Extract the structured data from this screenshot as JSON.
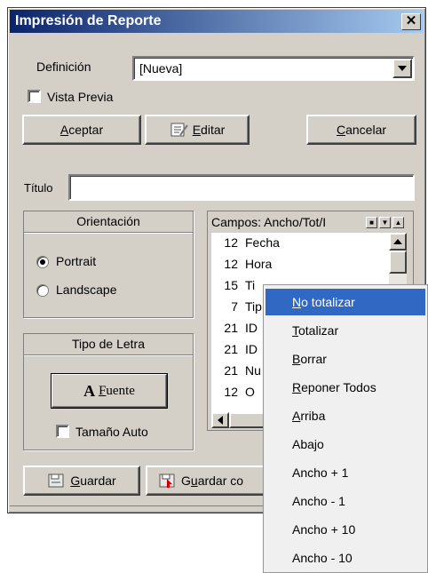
{
  "window": {
    "title": "Impresión de Reporte"
  },
  "definicion": {
    "label": "Definición",
    "value": "[Nueva]"
  },
  "vista_previa": {
    "label": "Vista Previa",
    "checked": false
  },
  "buttons": {
    "aceptar": {
      "u": "A",
      "rest": "ceptar"
    },
    "editar": {
      "u": "E",
      "rest": "ditar"
    },
    "cancelar": {
      "u": "C",
      "rest": "ancelar"
    },
    "fuente": {
      "icon": "A",
      "u": "F",
      "rest": "uente"
    },
    "guardar": {
      "u": "G",
      "rest": "uardar"
    },
    "guardar_como": {
      "pre": "G",
      "u": "u",
      "rest": "ardar co"
    }
  },
  "titulo": {
    "label": "Título",
    "value": ""
  },
  "orientacion": {
    "header": "Orientación",
    "options": [
      "Portrait",
      "Landscape"
    ],
    "selected": "Portrait"
  },
  "tipo_letra": {
    "header": "Tipo de Letra",
    "tamano_auto": "Tamaño Auto",
    "checked": false
  },
  "campos": {
    "header": "Campos: Ancho/Tot/I",
    "rows": [
      {
        "n": "12",
        "name": "Fecha"
      },
      {
        "n": "12",
        "name": "Hora"
      },
      {
        "n": "15",
        "name": "Ti"
      },
      {
        "n": "7",
        "name": "Tip"
      },
      {
        "n": "21",
        "name": "ID"
      },
      {
        "n": "21",
        "name": "ID"
      },
      {
        "n": "21",
        "name": "Nu"
      },
      {
        "n": "12",
        "name": "O"
      }
    ]
  },
  "context_menu": {
    "items": [
      {
        "u": "N",
        "rest": "o totalizar",
        "highlighted": true
      },
      {
        "u": "T",
        "rest": "otalizar"
      },
      {
        "u": "B",
        "rest": "orrar"
      },
      {
        "u": "R",
        "rest": "eponer Todos"
      },
      {
        "u": "A",
        "rest": "rriba"
      },
      {
        "u": "",
        "rest": "Abajo"
      },
      {
        "u": "",
        "rest": "Ancho + 1"
      },
      {
        "u": "",
        "rest": "Ancho - 1"
      },
      {
        "u": "",
        "rest": "Ancho + 10"
      },
      {
        "u": "",
        "rest": "Ancho - 10"
      }
    ]
  },
  "colors": {
    "titlebar_start": "#0a246a",
    "titlebar_end": "#a6caf0",
    "face": "#d4d0c8",
    "highlight": "#3168c4"
  }
}
